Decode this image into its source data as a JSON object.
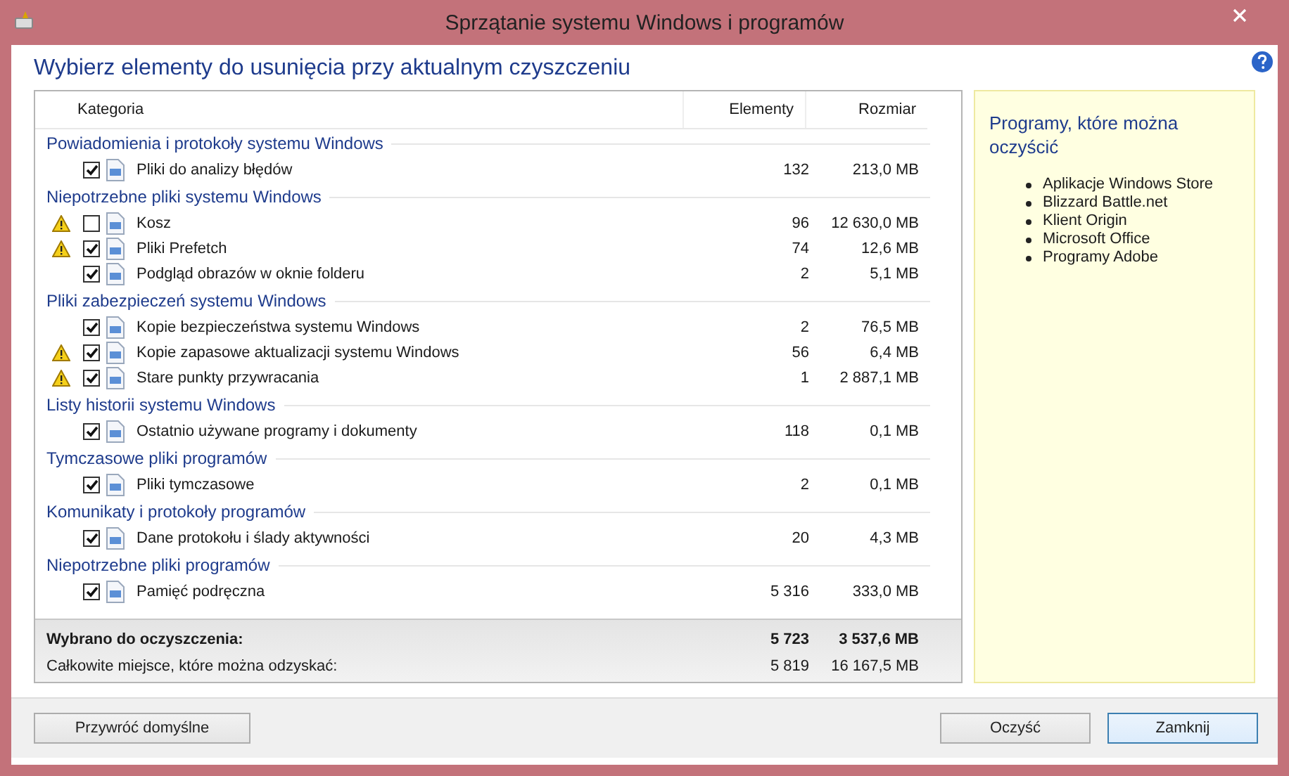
{
  "window": {
    "title": "Sprzątanie systemu Windows i programów"
  },
  "heading": "Wybierz elementy do usunięcia przy aktualnym czyszczeniu",
  "table": {
    "columns": [
      "Kategoria",
      "Elementy",
      "Rozmiar"
    ],
    "groups": [
      {
        "title": "Powiadomienia i protokoły systemu Windows",
        "items": [
          {
            "name": "Pliki do analizy błędów",
            "count": "132",
            "size": "213,0 MB",
            "checked": true,
            "warning": false
          }
        ]
      },
      {
        "title": "Niepotrzebne pliki systemu Windows",
        "items": [
          {
            "name": "Kosz",
            "count": "96",
            "size": "12 630,0 MB",
            "checked": false,
            "warning": true
          },
          {
            "name": "Pliki Prefetch",
            "count": "74",
            "size": "12,6 MB",
            "checked": true,
            "warning": true
          },
          {
            "name": "Podgląd obrazów w oknie folderu",
            "count": "2",
            "size": "5,1 MB",
            "checked": true,
            "warning": false
          }
        ]
      },
      {
        "title": "Pliki zabezpieczeń systemu Windows",
        "items": [
          {
            "name": "Kopie bezpieczeństwa systemu Windows",
            "count": "2",
            "size": "76,5 MB",
            "checked": true,
            "warning": false
          },
          {
            "name": "Kopie zapasowe aktualizacji systemu Windows",
            "count": "56",
            "size": "6,4 MB",
            "checked": true,
            "warning": true
          },
          {
            "name": "Stare punkty przywracania",
            "count": "1",
            "size": "2 887,1 MB",
            "checked": true,
            "warning": true
          }
        ]
      },
      {
        "title": "Listy historii systemu Windows",
        "items": [
          {
            "name": "Ostatnio używane programy i dokumenty",
            "count": "118",
            "size": "0,1 MB",
            "checked": true,
            "warning": false
          }
        ]
      },
      {
        "title": "Tymczasowe pliki programów",
        "items": [
          {
            "name": "Pliki tymczasowe",
            "count": "2",
            "size": "0,1 MB",
            "checked": true,
            "warning": false
          }
        ]
      },
      {
        "title": "Komunikaty i protokoły programów",
        "items": [
          {
            "name": "Dane protokołu i ślady aktywności",
            "count": "20",
            "size": "4,3 MB",
            "checked": true,
            "warning": false
          }
        ]
      },
      {
        "title": "Niepotrzebne pliki programów",
        "items": [
          {
            "name": "Pamięć podręczna",
            "count": "5 316",
            "size": "333,0 MB",
            "checked": true,
            "warning": false
          }
        ]
      }
    ],
    "totals": [
      {
        "label": "Wybrano do oczyszczenia:",
        "count": "5 723",
        "size": "3 537,6 MB",
        "bold": true
      },
      {
        "label": "Całkowite miejsce, które można odzyskać:",
        "count": "5 819",
        "size": "16 167,5 MB",
        "bold": false
      }
    ]
  },
  "side_panel": {
    "title": "Programy, które można oczyścić",
    "items": [
      "Aplikacje Windows Store",
      "Blizzard Battle.net",
      "Klient Origin",
      "Microsoft Office",
      "Programy Adobe"
    ]
  },
  "buttons": [
    {
      "label": "Przywróć domyślne",
      "default": false
    },
    {
      "label": "Oczyść",
      "default": false
    },
    {
      "label": "Zamknij",
      "default": true
    }
  ]
}
